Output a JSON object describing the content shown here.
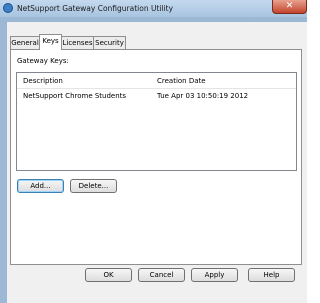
{
  "window": {
    "title": "NetSupport Gateway Configuration Utility",
    "close_glyph": "✕"
  },
  "tabs": [
    {
      "label": "General",
      "active": false
    },
    {
      "label": "Keys",
      "active": true
    },
    {
      "label": "Licenses",
      "active": false
    },
    {
      "label": "Security",
      "active": false
    }
  ],
  "keys_panel": {
    "section_label": "Gateway Keys:",
    "columns": {
      "description": "Description",
      "creation_date": "Creation Date"
    },
    "rows": [
      {
        "description": "NetSupport Chrome Students",
        "creation_date": "Tue Apr 03 10:50:19 2012"
      }
    ],
    "add_label": "Add...",
    "delete_label": "Delete..."
  },
  "footer": {
    "ok_label": "OK",
    "cancel_label": "Cancel",
    "apply_label": "Apply",
    "help_label": "Help"
  },
  "icons": {
    "title": "netsupport-app-icon",
    "close": "close-icon"
  }
}
